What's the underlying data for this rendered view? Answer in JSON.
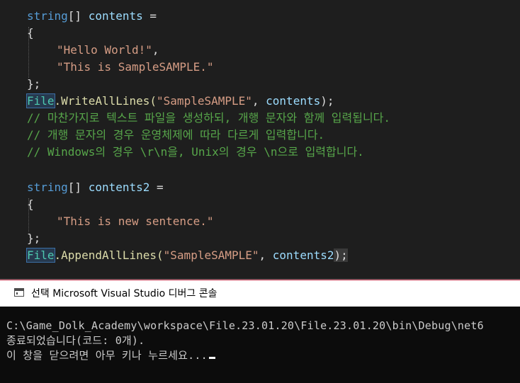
{
  "editor": {
    "lines": [
      {
        "a": "string",
        "b": "[]",
        "c": " contents",
        "d": " ="
      },
      {
        "text": "{"
      },
      {
        "text": "\"Hello World!\"",
        "tail": ","
      },
      {
        "text": "\"This is SampleSAMPLE.\""
      },
      {
        "text": "};"
      },
      {
        "type": "File",
        "method": ".WriteAllLines(",
        "str": "\"SampleSAMPLE\"",
        "sep": ", ",
        "arg": "contents",
        "end": ");"
      },
      {
        "text": "// 마찬가지로 텍스트 파일을 생성하되, 개행 문자와 함께 입력됩니다."
      },
      {
        "text": "// 개행 문자의 경우 운영체제에 따라 다르게 입력합니다."
      },
      {
        "text": "// Windows의 경우 \\r\\n을, Unix의 경우 \\n으로 입력합니다."
      },
      {
        "a": "string",
        "b": "[]",
        "c": " contents2",
        "d": " ="
      },
      {
        "text": "{"
      },
      {
        "text": "\"This is new sentence.\""
      },
      {
        "text": "};"
      },
      {
        "type": "File",
        "method": ".AppendAllLines(",
        "str": "\"SampleSAMPLE\"",
        "sep": ", ",
        "arg": "contents2",
        "end": ");"
      }
    ]
  },
  "console": {
    "title": "선택 Microsoft Visual Studio 디버그 콘솔",
    "output": [
      "C:\\Game_Dolk_Academy\\workspace\\File.23.01.20\\File.23.01.20\\bin\\Debug\\net6",
      "종료되었습니다(코드: 0개).",
      "이 창을 닫으려면 아무 키나 누르세요..."
    ]
  },
  "colors": {
    "keyword": "#569cd6",
    "identifier": "#9cdcfe",
    "string": "#d69d85",
    "method": "#dcdcaa",
    "type": "#4ec9b0",
    "comment": "#57a64a",
    "editor_bg": "#1e1e1e",
    "console_bg": "#0c0c0c"
  }
}
